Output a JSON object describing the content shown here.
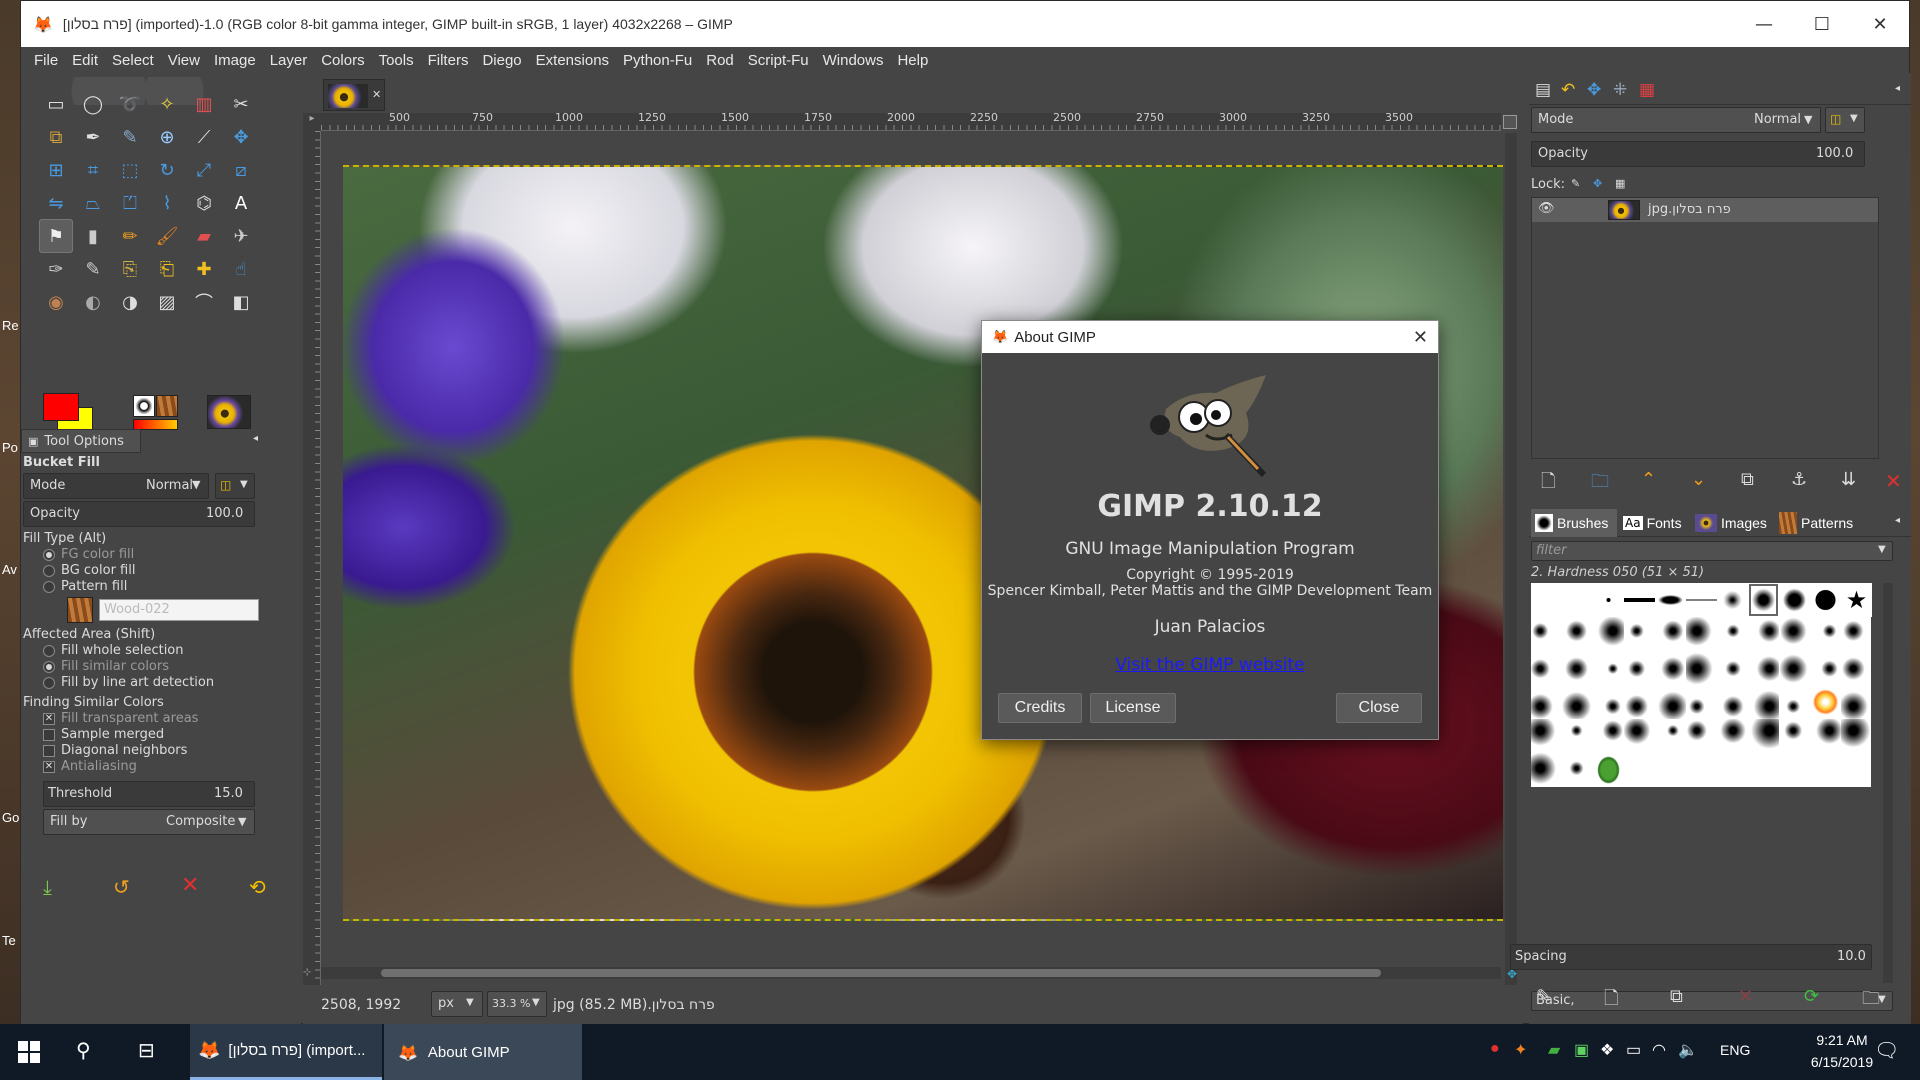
{
  "window": {
    "title": "[פרח בסלון] (imported)-1.0 (RGB color 8-bit gamma integer, GIMP built-in sRGB, 1 layer) 4032x2268 – GIMP",
    "minimize": "—",
    "maximize": "☐",
    "close": "✕"
  },
  "menu": [
    "File",
    "Edit",
    "Select",
    "View",
    "Image",
    "Layer",
    "Colors",
    "Tools",
    "Filters",
    "Diego",
    "Extensions",
    "Python-Fu",
    "Rod",
    "Script-Fu",
    "Windows",
    "Help"
  ],
  "tool_options": {
    "tab_label": "Tool Options",
    "tool_name": "Bucket Fill",
    "mode_label": "Mode",
    "mode_value": "Normal",
    "opacity_label": "Opacity",
    "opacity_value": "100.0",
    "fill_type_label": "Fill Type  (Alt)",
    "fill_types": [
      "FG color fill",
      "BG color fill",
      "Pattern fill"
    ],
    "pattern_name": "Wood-022",
    "affected_label": "Affected Area  (Shift)",
    "affected": [
      "Fill whole selection",
      "Fill similar colors",
      "Fill by line art detection"
    ],
    "finding_label": "Finding Similar Colors",
    "finding": [
      "Fill transparent areas",
      "Sample merged",
      "Diagonal neighbors",
      "Antialiasing"
    ],
    "threshold_label": "Threshold",
    "threshold_value": "15.0",
    "fillby_label": "Fill by",
    "fillby_value": "Composite"
  },
  "ruler": [
    "500",
    "750",
    "1000",
    "1250",
    "1500",
    "1750",
    "2000",
    "2250",
    "2500",
    "2750",
    "3000",
    "3250",
    "3500"
  ],
  "status": {
    "coords": "2508, 1992",
    "unit": "px",
    "zoom": "33.3 %",
    "info": "פרח בסלון.jpg (85.2 MB)"
  },
  "layers": {
    "mode_label": "Mode",
    "mode_value": "Normal",
    "opacity_label": "Opacity",
    "opacity_value": "100.0",
    "lock_label": "Lock:",
    "layer_name": "פרח בסלון.jpg"
  },
  "brushes": {
    "tabs": [
      "Brushes",
      "Fonts",
      "Images",
      "Patterns"
    ],
    "filter_placeholder": "filter",
    "current": "2. Hardness 050 (51 × 51)",
    "preset": "Basic,",
    "spacing_label": "Spacing",
    "spacing_value": "10.0"
  },
  "about": {
    "title": "About GIMP",
    "version": "GIMP 2.10.12",
    "program": "GNU Image Manipulation Program",
    "copyright": "Copyright © 1995-2019",
    "authors": "Spencer Kimball, Peter Mattis and the GIMP Development Team",
    "translator": "Juan Palacios",
    "link": "Visit the GIMP website",
    "credits": "Credits",
    "license": "License",
    "close": "Close"
  },
  "desktop_labels": [
    "Re",
    "Po",
    "Av",
    "Go",
    "Te"
  ],
  "taskbar": {
    "task1": "[פרח בסלון] (import...",
    "task2": "About GIMP",
    "lang": "ENG",
    "time": "9:21 AM",
    "date": "6/15/2019"
  },
  "colors": {
    "fg": "#ff0000",
    "bg": "#ffff00",
    "accent": "#0078d7",
    "link": "#1a1aff"
  }
}
